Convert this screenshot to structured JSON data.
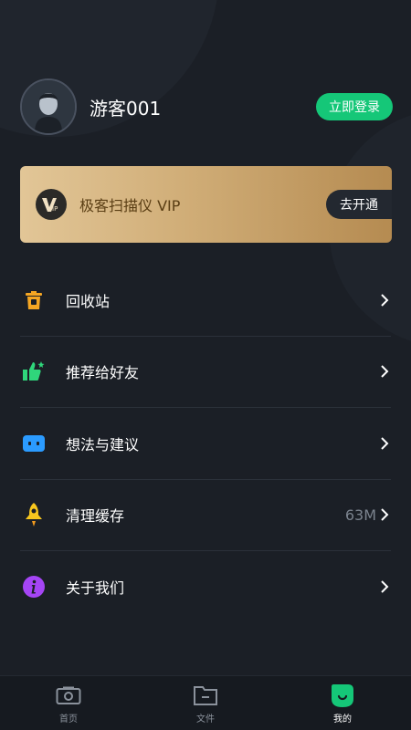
{
  "profile": {
    "username": "游客001",
    "login_label": "立即登录"
  },
  "vip": {
    "title": "极客扫描仪 VIP",
    "button_label": "去开通"
  },
  "menu": {
    "items": [
      {
        "label": "回收站",
        "value": "",
        "icon": "trash-icon",
        "color": "#f5a623"
      },
      {
        "label": "推荐给好友",
        "value": "",
        "icon": "thumbs-up-icon",
        "color": "#2fd67b"
      },
      {
        "label": "想法与建议",
        "value": "",
        "icon": "chat-icon",
        "color": "#2b9bff"
      },
      {
        "label": "清理缓存",
        "value": "63M",
        "icon": "rocket-icon",
        "color": "#f7c61e"
      },
      {
        "label": "关于我们",
        "value": "",
        "icon": "info-icon",
        "color": "#a545f5"
      }
    ]
  },
  "bottom_nav": {
    "tabs": [
      {
        "label": "首页",
        "icon": "camera-icon",
        "active": false
      },
      {
        "label": "文件",
        "icon": "folder-icon",
        "active": false
      },
      {
        "label": "我的",
        "icon": "profile-icon",
        "active": true
      }
    ]
  },
  "colors": {
    "background": "#1b1f26",
    "accent": "#15c778",
    "vip_gold": "#d0ad77"
  }
}
